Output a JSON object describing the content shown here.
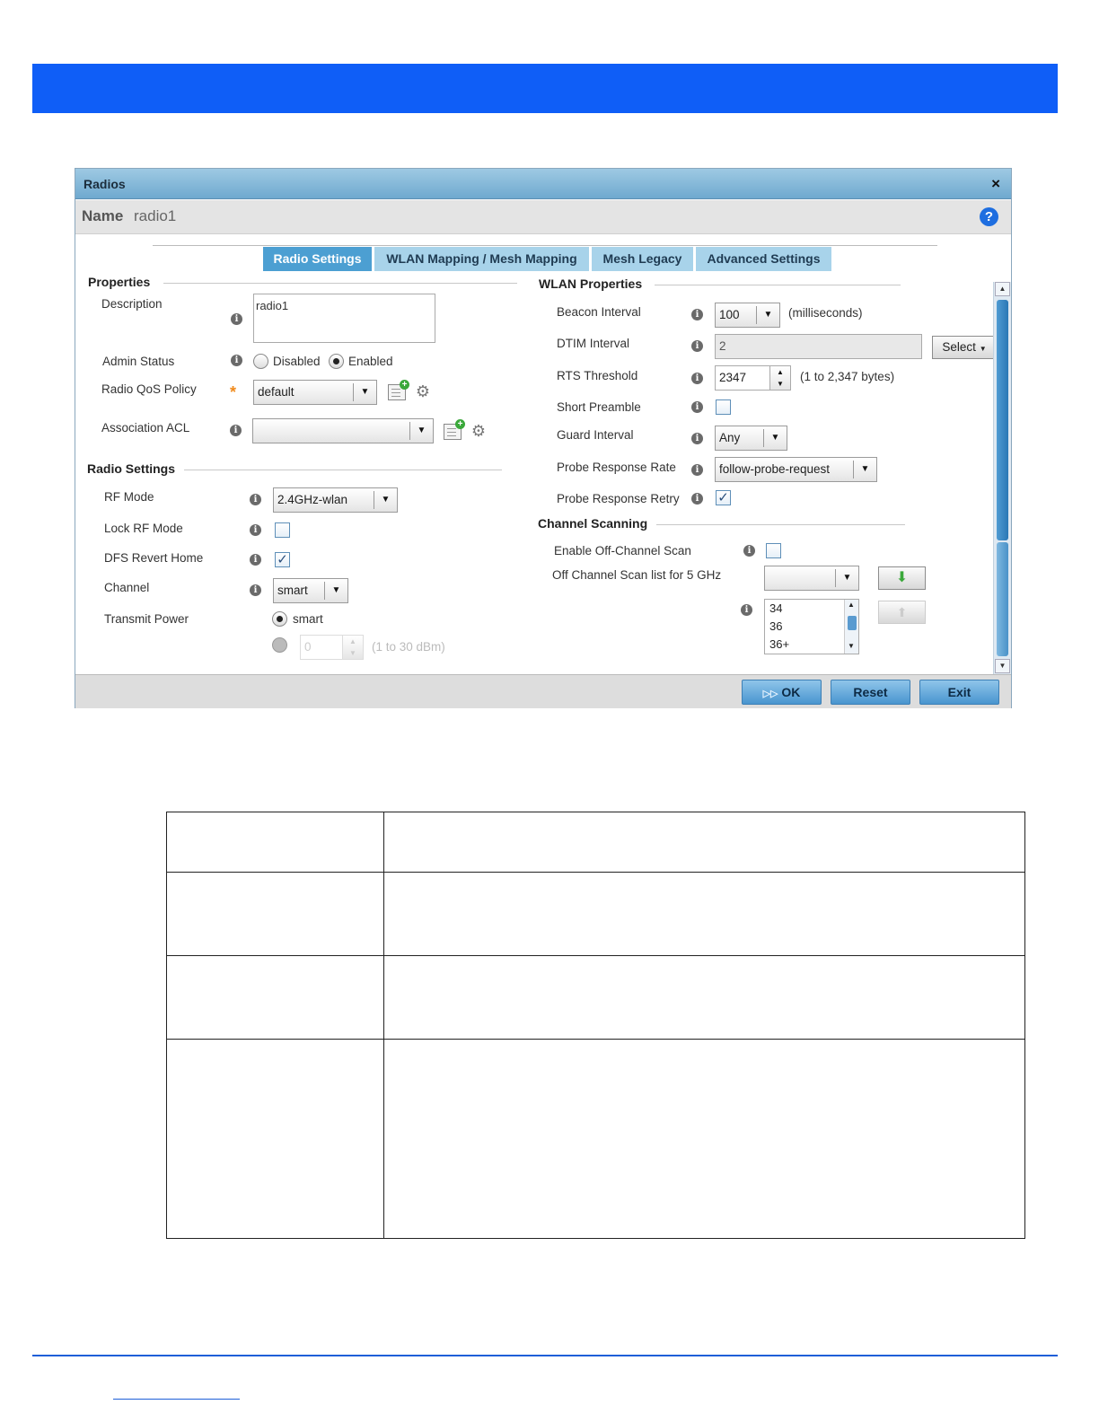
{
  "dialog": {
    "title": "Radios",
    "close_label": "×",
    "name_label": "Name",
    "name_value": "radio1",
    "help_label": "?"
  },
  "tabs": [
    {
      "label": "Radio Settings",
      "active": true
    },
    {
      "label": "WLAN Mapping / Mesh Mapping",
      "active": false
    },
    {
      "label": "Mesh Legacy",
      "active": false
    },
    {
      "label": "Advanced Settings",
      "active": false
    }
  ],
  "properties": {
    "section_title": "Properties",
    "description_label": "Description",
    "description_value": "radio1",
    "admin_status_label": "Admin Status",
    "admin_disabled_label": "Disabled",
    "admin_enabled_label": "Enabled",
    "admin_status_value": "Enabled",
    "qos_label": "Radio QoS Policy",
    "qos_value": "default",
    "acl_label": "Association ACL",
    "acl_value": ""
  },
  "radio_settings": {
    "section_title": "Radio Settings",
    "rf_mode_label": "RF Mode",
    "rf_mode_value": "2.4GHz-wlan",
    "lock_rf_label": "Lock RF Mode",
    "lock_rf_checked": false,
    "dfs_label": "DFS Revert Home",
    "dfs_checked": true,
    "channel_label": "Channel",
    "channel_value": "smart",
    "tx_power_label": "Transmit Power",
    "tx_smart_label": "smart",
    "tx_power_value": "0",
    "tx_power_hint": "(1 to 30 dBm)"
  },
  "wlan_properties": {
    "section_title": "WLAN Properties",
    "beacon_label": "Beacon Interval",
    "beacon_value": "100",
    "beacon_unit": "(milliseconds)",
    "dtim_label": "DTIM Interval",
    "dtim_value": "2",
    "dtim_select_label": "Select",
    "rts_label": "RTS Threshold",
    "rts_value": "2347",
    "rts_hint": "(1 to 2,347 bytes)",
    "short_preamble_label": "Short Preamble",
    "short_preamble_checked": false,
    "guard_label": "Guard Interval",
    "guard_value": "Any",
    "probe_rate_label": "Probe Response Rate",
    "probe_rate_value": "follow-probe-request",
    "probe_retry_label": "Probe Response Retry",
    "probe_retry_checked": true
  },
  "channel_scanning": {
    "section_title": "Channel Scanning",
    "enable_label": "Enable Off-Channel Scan",
    "enable_checked": false,
    "scan_list_label": "Off Channel Scan list for 5 GHz",
    "scan_list_select_value": "",
    "scan_list_items": [
      "34",
      "36",
      "36+"
    ]
  },
  "footer": {
    "ok_label": "OK",
    "reset_label": "Reset",
    "exit_label": "Exit"
  },
  "icons": {
    "info_glyph": "i",
    "required_glyph": "*",
    "check_glyph": "✓",
    "dropdown_glyph": "▼",
    "up_glyph": "▲",
    "down_glyph": "▼",
    "gear_glyph": "⚙",
    "plus_glyph": "+",
    "ok_glyph": "▷▷",
    "down_arrow_glyph": "⬇",
    "up_arrow_glyph": "⬆"
  },
  "colors": {
    "banner": "#0f5ef7",
    "accent": "#4c9fd2",
    "rule": "#1e5fd8"
  }
}
